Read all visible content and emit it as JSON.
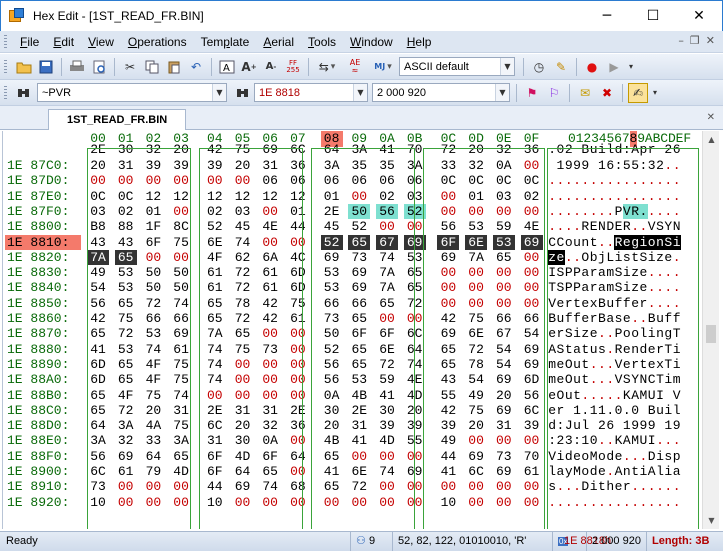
{
  "window": {
    "title": "Hex Edit - [1ST_READ_FR.BIN]"
  },
  "menu": [
    "File",
    "Edit",
    "View",
    "Operations",
    "Template",
    "Aerial",
    "Tools",
    "Window",
    "Help"
  ],
  "menu_accel": [
    "F",
    "E",
    "V",
    "O",
    "p",
    "A",
    "T",
    "W",
    "H"
  ],
  "toolbar": {
    "char_set_value": "ASCII default",
    "search_value": "~PVR",
    "address_value": "1E 8818",
    "number_value": "2 000 920",
    "icons": [
      "open-icon",
      "save-icon",
      "print-icon",
      "print-preview-icon",
      "cut-icon",
      "copy-icon",
      "paste-icon",
      "undo-icon",
      "font-icon",
      "font-increase-icon",
      "font-decrease-icon",
      "display-mode-icon",
      "ebcdic-icon",
      "ascii-icon",
      "endian-icon",
      "clock-icon",
      "highlight-icon",
      "record-icon",
      "play-icon"
    ]
  },
  "tab": {
    "label": "1ST_READ_FR.BIN"
  },
  "hex": {
    "header_cols": [
      "00",
      "01",
      "02",
      "03",
      "04",
      "05",
      "06",
      "07",
      "08",
      "09",
      "0A",
      "0B",
      "0C",
      "0D",
      "0E",
      "0F"
    ],
    "ascii_header": "0123456789ABCDEF",
    "active_col_index": 8,
    "partial_top": {
      "bytes": [
        "2E",
        "30",
        "32",
        "20",
        "42",
        "75",
        "69",
        "6C",
        "64",
        "3A",
        "41",
        "70",
        "72",
        "20",
        "32",
        "36"
      ],
      "ascii": ".02 Build:Apr 26"
    },
    "rows": [
      {
        "addr": "1E 87C0:",
        "bytes": [
          "20",
          "31",
          "39",
          "39",
          "39",
          "20",
          "31",
          "36",
          "3A",
          "35",
          "35",
          "3A",
          "33",
          "32",
          "0A",
          "00"
        ],
        "ascii": " 1999 16:55:32.."
      },
      {
        "addr": "1E 87D0:",
        "bytes": [
          "00",
          "00",
          "00",
          "00",
          "00",
          "00",
          "06",
          "06",
          "06",
          "06",
          "06",
          "06",
          "0C",
          "0C",
          "0C",
          "0C"
        ],
        "ascii": "................"
      },
      {
        "addr": "1E 87E0:",
        "bytes": [
          "0C",
          "0C",
          "12",
          "12",
          "12",
          "12",
          "12",
          "12",
          "01",
          "00",
          "02",
          "03",
          "00",
          "01",
          "03",
          "02"
        ],
        "ascii": "................"
      },
      {
        "addr": "1E 87F0:",
        "bytes": [
          "03",
          "02",
          "01",
          "00",
          "02",
          "03",
          "00",
          "01",
          "2E",
          "50",
          "56",
          "52",
          "00",
          "00",
          "00",
          "00"
        ],
        "ascii": "........PVR....."
      },
      {
        "addr": "1E 8800:",
        "bytes": [
          "B8",
          "88",
          "1F",
          "8C",
          "52",
          "45",
          "4E",
          "44",
          "45",
          "52",
          "00",
          "00",
          "56",
          "53",
          "59",
          "4E"
        ],
        "ascii": "....RENDER..VSYN"
      },
      {
        "addr": "1E 8810:",
        "bytes": [
          "43",
          "43",
          "6F",
          "75",
          "6E",
          "74",
          "00",
          "00",
          "52",
          "65",
          "67",
          "69",
          "6F",
          "6E",
          "53",
          "69"
        ],
        "ascii": "CCount..RegionSi"
      },
      {
        "addr": "1E 8820:",
        "bytes": [
          "7A",
          "65",
          "00",
          "00",
          "4F",
          "62",
          "6A",
          "4C",
          "69",
          "73",
          "74",
          "53",
          "69",
          "7A",
          "65",
          "00"
        ],
        "ascii": "ze..ObjListSize."
      },
      {
        "addr": "1E 8830:",
        "bytes": [
          "49",
          "53",
          "50",
          "50",
          "61",
          "72",
          "61",
          "6D",
          "53",
          "69",
          "7A",
          "65",
          "00",
          "00",
          "00",
          "00"
        ],
        "ascii": "ISPParamSize...."
      },
      {
        "addr": "1E 8840:",
        "bytes": [
          "54",
          "53",
          "50",
          "50",
          "61",
          "72",
          "61",
          "6D",
          "53",
          "69",
          "7A",
          "65",
          "00",
          "00",
          "00",
          "00"
        ],
        "ascii": "TSPParamSize...."
      },
      {
        "addr": "1E 8850:",
        "bytes": [
          "56",
          "65",
          "72",
          "74",
          "65",
          "78",
          "42",
          "75",
          "66",
          "66",
          "65",
          "72",
          "00",
          "00",
          "00",
          "00"
        ],
        "ascii": "VertexBuffer...."
      },
      {
        "addr": "1E 8860:",
        "bytes": [
          "42",
          "75",
          "66",
          "66",
          "65",
          "72",
          "42",
          "61",
          "73",
          "65",
          "00",
          "00",
          "42",
          "75",
          "66",
          "66"
        ],
        "ascii": "BufferBase..Buff"
      },
      {
        "addr": "1E 8870:",
        "bytes": [
          "65",
          "72",
          "53",
          "69",
          "7A",
          "65",
          "00",
          "00",
          "50",
          "6F",
          "6F",
          "6C",
          "69",
          "6E",
          "67",
          "54"
        ],
        "ascii": "erSize..PoolingT"
      },
      {
        "addr": "1E 8880:",
        "bytes": [
          "41",
          "53",
          "74",
          "61",
          "74",
          "75",
          "73",
          "00",
          "52",
          "65",
          "6E",
          "64",
          "65",
          "72",
          "54",
          "69"
        ],
        "ascii": "AStatus.RenderTi"
      },
      {
        "addr": "1E 8890:",
        "bytes": [
          "6D",
          "65",
          "4F",
          "75",
          "74",
          "00",
          "00",
          "00",
          "56",
          "65",
          "72",
          "74",
          "65",
          "78",
          "54",
          "69"
        ],
        "ascii": "meOut...VertexTi"
      },
      {
        "addr": "1E 88A0:",
        "bytes": [
          "6D",
          "65",
          "4F",
          "75",
          "74",
          "00",
          "00",
          "00",
          "56",
          "53",
          "59",
          "4E",
          "43",
          "54",
          "69",
          "6D"
        ],
        "ascii": "meOut...VSYNCTim"
      },
      {
        "addr": "1E 88B0:",
        "bytes": [
          "65",
          "4F",
          "75",
          "74",
          "00",
          "00",
          "00",
          "00",
          "0A",
          "4B",
          "41",
          "4D",
          "55",
          "49",
          "20",
          "56"
        ],
        "ascii": "eOut.....KAMUI V"
      },
      {
        "addr": "1E 88C0:",
        "bytes": [
          "65",
          "72",
          "20",
          "31",
          "2E",
          "31",
          "31",
          "2E",
          "30",
          "2E",
          "30",
          "20",
          "42",
          "75",
          "69",
          "6C"
        ],
        "ascii": "er 1.11.0.0 Buil"
      },
      {
        "addr": "1E 88D0:",
        "bytes": [
          "64",
          "3A",
          "4A",
          "75",
          "6C",
          "20",
          "32",
          "36",
          "20",
          "31",
          "39",
          "39",
          "39",
          "20",
          "31",
          "39"
        ],
        "ascii": "d:Jul 26 1999 19"
      },
      {
        "addr": "1E 88E0:",
        "bytes": [
          "3A",
          "32",
          "33",
          "3A",
          "31",
          "30",
          "0A",
          "00",
          "4B",
          "41",
          "4D",
          "55",
          "49",
          "00",
          "00",
          "00"
        ],
        "ascii": ":23:10..KAMUI..."
      },
      {
        "addr": "1E 88F0:",
        "bytes": [
          "56",
          "69",
          "64",
          "65",
          "6F",
          "4D",
          "6F",
          "64",
          "65",
          "00",
          "00",
          "00",
          "44",
          "69",
          "73",
          "70"
        ],
        "ascii": "VideoMode...Disp"
      },
      {
        "addr": "1E 8900:",
        "bytes": [
          "6C",
          "61",
          "79",
          "4D",
          "6F",
          "64",
          "65",
          "00",
          "41",
          "6E",
          "74",
          "69",
          "41",
          "6C",
          "69",
          "61"
        ],
        "ascii": "layMode.AntiAlia"
      },
      {
        "addr": "1E 8910:",
        "bytes": [
          "73",
          "00",
          "00",
          "00",
          "44",
          "69",
          "74",
          "68",
          "65",
          "72",
          "00",
          "00",
          "00",
          "00",
          "00",
          "00"
        ],
        "ascii": "s...Dither......"
      },
      {
        "addr": "1E 8920:",
        "bytes": [
          "10",
          "00",
          "00",
          "00",
          "10",
          "00",
          "00",
          "00",
          "00",
          "00",
          "00",
          "00",
          "10",
          "00",
          "00",
          "00"
        ],
        "ascii": "................"
      }
    ],
    "active_row_index": 5
  },
  "status": {
    "ready": "Ready",
    "line": "9",
    "values": "52, 82, 122, 01010010, 'R'",
    "address": "1E 8818h",
    "decimal": "2 000 920",
    "length": "Length: 3B"
  }
}
